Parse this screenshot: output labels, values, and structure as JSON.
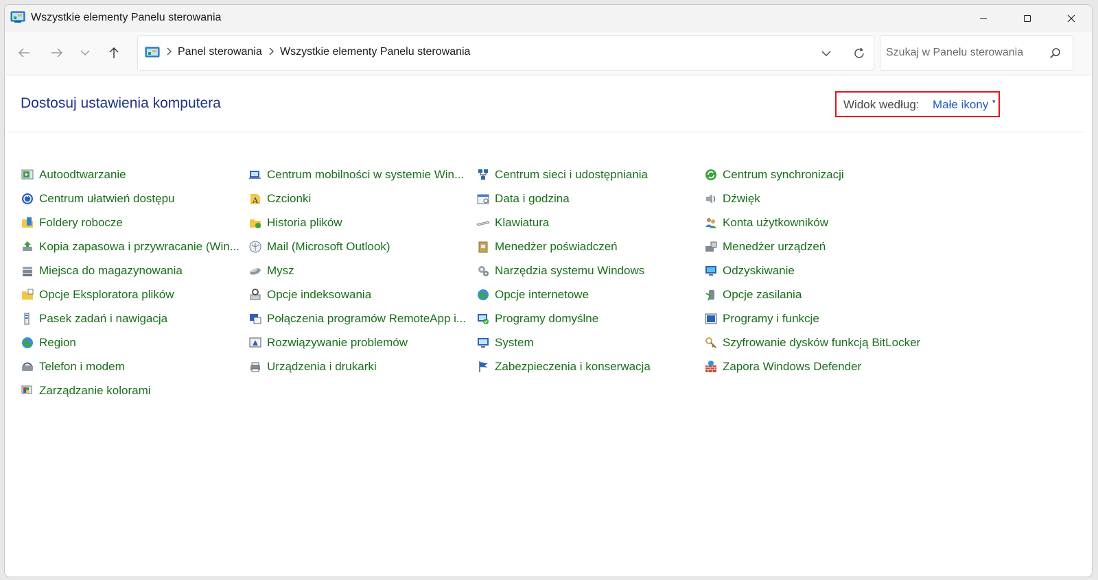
{
  "window": {
    "title": "Wszystkie elementy Panelu sterowania"
  },
  "nav": {
    "breadcrumb": [
      "Panel sterowania",
      "Wszystkie elementy Panelu sterowania"
    ],
    "search_placeholder": "Szukaj w Panelu sterowania"
  },
  "content": {
    "heading": "Dostosuj ustawienia komputera",
    "view_by_label": "Widok według:",
    "view_by_value": "Małe ikony"
  },
  "columns": [
    [
      {
        "label": "Autoodtwarzanie",
        "icon": "autoplay-icon"
      },
      {
        "label": "Centrum ułatwień dostępu",
        "icon": "ease-of-access-icon"
      },
      {
        "label": "Foldery robocze",
        "icon": "work-folders-icon"
      },
      {
        "label": "Kopia zapasowa i przywracanie (Win...",
        "icon": "backup-icon"
      },
      {
        "label": "Miejsca do magazynowania",
        "icon": "storage-spaces-icon"
      },
      {
        "label": "Opcje Eksploratora plików",
        "icon": "folder-options-icon"
      },
      {
        "label": "Pasek zadań i nawigacja",
        "icon": "taskbar-icon"
      },
      {
        "label": "Region",
        "icon": "region-icon"
      },
      {
        "label": "Telefon i modem",
        "icon": "phone-modem-icon"
      },
      {
        "label": "Zarządzanie kolorami",
        "icon": "color-management-icon"
      }
    ],
    [
      {
        "label": "Centrum mobilności w systemie Win...",
        "icon": "mobility-center-icon"
      },
      {
        "label": "Czcionki",
        "icon": "fonts-icon"
      },
      {
        "label": "Historia plików",
        "icon": "file-history-icon"
      },
      {
        "label": "Mail (Microsoft Outlook)",
        "icon": "mail-icon"
      },
      {
        "label": "Mysz",
        "icon": "mouse-icon"
      },
      {
        "label": "Opcje indeksowania",
        "icon": "indexing-icon"
      },
      {
        "label": "Połączenia programów RemoteApp i...",
        "icon": "remoteapp-icon"
      },
      {
        "label": "Rozwiązywanie problemów",
        "icon": "troubleshooting-icon"
      },
      {
        "label": "Urządzenia i drukarki",
        "icon": "devices-printers-icon"
      }
    ],
    [
      {
        "label": "Centrum sieci i udostępniania",
        "icon": "network-center-icon"
      },
      {
        "label": "Data i godzina",
        "icon": "date-time-icon"
      },
      {
        "label": "Klawiatura",
        "icon": "keyboard-icon"
      },
      {
        "label": "Menedżer poświadczeń",
        "icon": "credential-manager-icon"
      },
      {
        "label": "Narzędzia systemu Windows",
        "icon": "windows-tools-icon"
      },
      {
        "label": "Opcje internetowe",
        "icon": "internet-options-icon"
      },
      {
        "label": "Programy domyślne",
        "icon": "default-programs-icon"
      },
      {
        "label": "System",
        "icon": "system-icon"
      },
      {
        "label": "Zabezpieczenia i konserwacja",
        "icon": "security-maintenance-icon"
      }
    ],
    [
      {
        "label": "Centrum synchronizacji",
        "icon": "sync-center-icon"
      },
      {
        "label": "Dźwięk",
        "icon": "sound-icon"
      },
      {
        "label": "Konta użytkowników",
        "icon": "user-accounts-icon"
      },
      {
        "label": "Menedżer urządzeń",
        "icon": "device-manager-icon"
      },
      {
        "label": "Odzyskiwanie",
        "icon": "recovery-icon"
      },
      {
        "label": "Opcje zasilania",
        "icon": "power-options-icon"
      },
      {
        "label": "Programy i funkcje",
        "icon": "programs-features-icon"
      },
      {
        "label": "Szyfrowanie dysków funkcją BitLocker",
        "icon": "bitlocker-icon"
      },
      {
        "label": "Zapora Windows Defender",
        "icon": "firewall-icon"
      }
    ]
  ],
  "colors": {
    "heading": "#1e3287",
    "link": "#1a6e1a",
    "view_value": "#1f5bc0",
    "highlight_box": "#e0141e"
  }
}
